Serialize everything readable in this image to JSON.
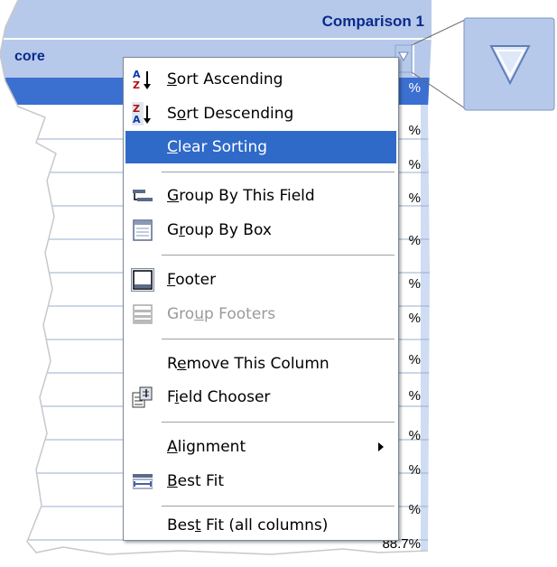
{
  "grid": {
    "group_header": "Comparison 1",
    "column_header": "core",
    "row_suffix": "%",
    "rows": [
      "%",
      "%",
      "%",
      "%",
      "%",
      "%",
      "%",
      "%",
      "%",
      "%",
      "%",
      "%",
      "%",
      "%"
    ],
    "last_row_value": "88.7%"
  },
  "colors": {
    "header_bg": "#a9bfe6",
    "selected_bg": "#2f6ac8",
    "text_blue": "#0a2a8c"
  },
  "menu": {
    "items": [
      {
        "id": "sort-ascending",
        "pre": "",
        "u": "S",
        "post": "ort Ascending",
        "icon": "sort-ascending-icon",
        "state": "normal"
      },
      {
        "id": "sort-descending",
        "pre": "S",
        "u": "o",
        "post": "rt Descending",
        "icon": "sort-descending-icon",
        "state": "normal"
      },
      {
        "id": "clear-sorting",
        "pre": "",
        "u": "C",
        "post": "lear Sorting",
        "icon": "",
        "state": "selected"
      },
      {
        "id": "group-by-this-field",
        "pre": "",
        "u": "G",
        "post": "roup By This Field",
        "icon": "group-by-field-icon",
        "state": "normal"
      },
      {
        "id": "group-by-box",
        "pre": "G",
        "u": "r",
        "post": "oup By Box",
        "icon": "group-by-box-icon",
        "state": "normal"
      },
      {
        "id": "footer",
        "pre": "",
        "u": "F",
        "post": "ooter",
        "icon": "footer-icon",
        "state": "normal"
      },
      {
        "id": "group-footers",
        "pre": "Gro",
        "u": "u",
        "post": "p Footers",
        "icon": "group-footers-icon",
        "state": "disabled"
      },
      {
        "id": "remove-this-column",
        "pre": "R",
        "u": "e",
        "post": "move This Column",
        "icon": "",
        "state": "normal"
      },
      {
        "id": "field-chooser",
        "pre": "F",
        "u": "i",
        "post": "eld Chooser",
        "icon": "field-chooser-icon",
        "state": "normal"
      },
      {
        "id": "alignment",
        "pre": "",
        "u": "A",
        "post": "lignment",
        "icon": "",
        "state": "normal",
        "submenu": true
      },
      {
        "id": "best-fit",
        "pre": "",
        "u": "B",
        "post": "est Fit",
        "icon": "best-fit-icon",
        "state": "normal"
      },
      {
        "id": "best-fit-all",
        "pre": "Bes",
        "u": "t",
        "post": " Fit (all columns)",
        "icon": "",
        "state": "normal"
      }
    ]
  },
  "zoom": {
    "icon": "filter-icon"
  }
}
